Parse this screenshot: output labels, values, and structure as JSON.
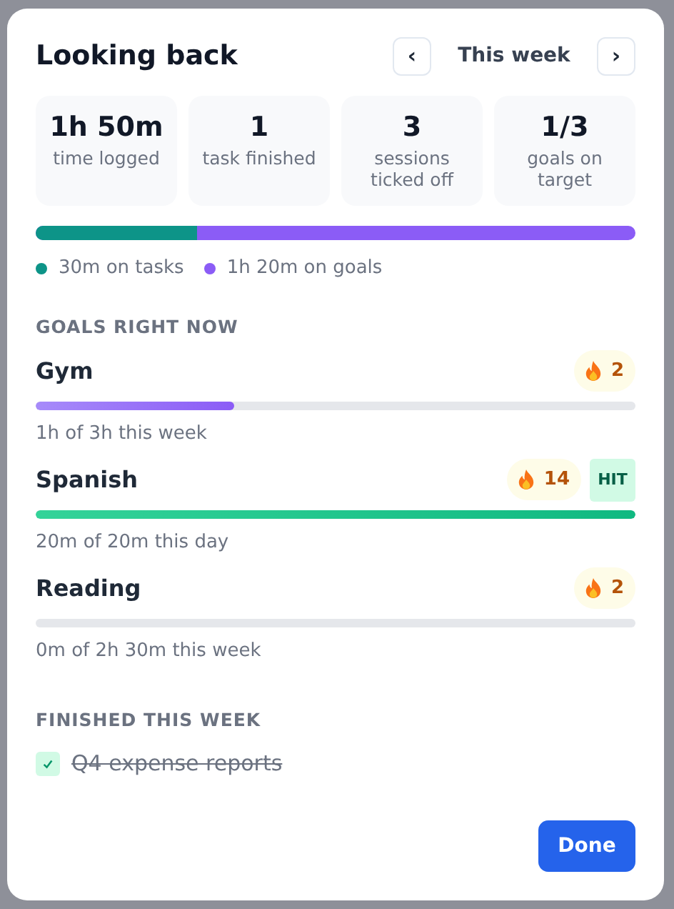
{
  "title": "Looking back",
  "period": {
    "prev": "‹",
    "label": "This week",
    "next": "›"
  },
  "stats": [
    {
      "value": "1h 50m",
      "label": "time logged"
    },
    {
      "value": "1",
      "label": "task finished"
    },
    {
      "value": "3",
      "label": "sessions ticked off"
    },
    {
      "value": "1/3",
      "label": "goals on target"
    }
  ],
  "split": [
    {
      "label": "30m on tasks",
      "level": 0.27,
      "color": "#0d9488"
    },
    {
      "label": "1h 20m on goals",
      "color": "#8b5cf6"
    }
  ],
  "goals_heading": "GOALS RIGHT NOW",
  "goals": [
    {
      "name": "Gym",
      "streak": "2",
      "hit": false,
      "level": 0.33,
      "caption": "1h of 3h this week"
    },
    {
      "name": "Spanish",
      "streak": "14",
      "hit": true,
      "hit_label": "HIT",
      "level": 1,
      "caption": "20m of 20m this day"
    },
    {
      "name": "Reading",
      "streak": "2",
      "hit": false,
      "level": 0,
      "caption": "0m of 2h 30m this week"
    }
  ],
  "finished_heading": "FINISHED THIS WEEK",
  "finished": [
    {
      "label": "Q4 expense reports",
      "checked": true
    }
  ],
  "done_button": "Done"
}
